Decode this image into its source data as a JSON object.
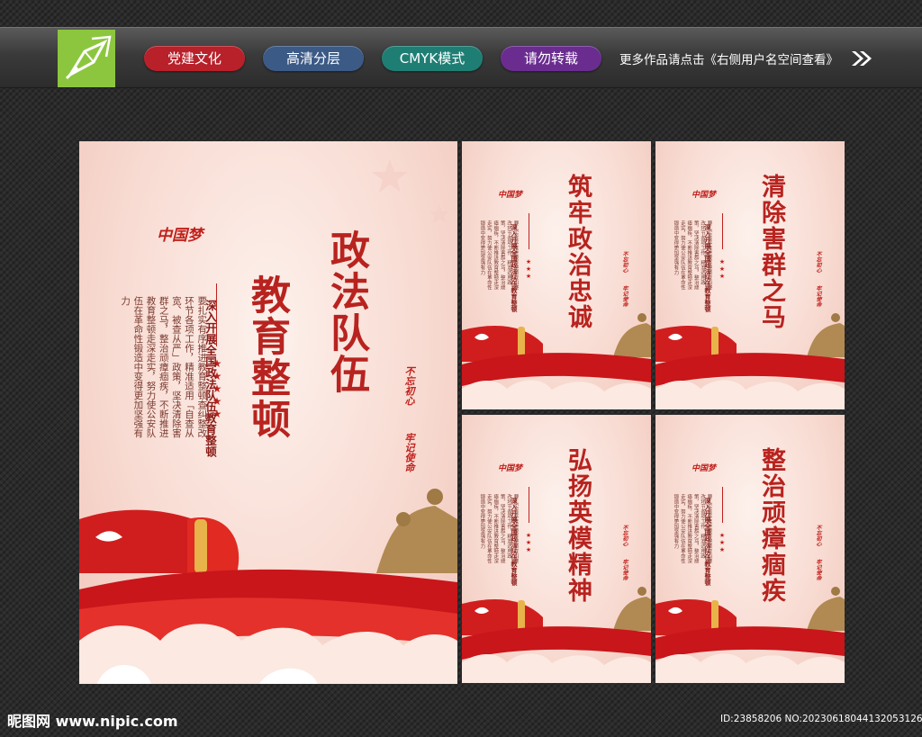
{
  "header": {
    "pills": [
      {
        "label": "党建文化",
        "color": "#b8202a"
      },
      {
        "label": "高清分层",
        "color": "#3c5a86"
      },
      {
        "label": "CMYK模式",
        "color": "#1f7e74"
      },
      {
        "label": "请勿转载",
        "color": "#6a2d8f"
      }
    ],
    "more_text": "更多作品请点击《右侧用户名空间查看》",
    "logo_icon": "pen-nib-icon",
    "arrow_icon": "double-chevron-right-icon"
  },
  "main_poster": {
    "title_line1": "政法队伍",
    "title_line2": "教育整顿",
    "china_dream": "中国梦",
    "subtitle": "深入开展全国政法队伍教育整顿",
    "body": "要扎实有序推进教育整顿查纠整改环节各项工作，精准适用「自查从宽、被查从严」政策，坚决清除害群之马，整治顽瘴痼疾，不断推进教育整顿走深走实，努力使公安队伍在革命性锻造中变得更加坚强有力",
    "slogan1": "不忘初心",
    "slogan2": "牢记使命"
  },
  "small_posters": [
    {
      "title": "筑牢政治忠诚"
    },
    {
      "title": "清除害群之马"
    },
    {
      "title": "弘扬英模精神"
    },
    {
      "title": "整治顽瘴痼疾"
    }
  ],
  "small_common": {
    "china_dream": "中国梦",
    "subtitle": "深入开展全国政法队伍教育整顿",
    "body": "要扎实有序推进教育整顿查纠整改环节各项工作，精准适用政策，坚决清除害群之马，整治顽瘴痼疾，不断推进教育整顿走深走实，努力使公安队伍在革命性锻造中变得更加坚强有力",
    "slogan1": "不忘初心",
    "slogan2": "牢记使命"
  },
  "footer": {
    "left": "昵图网 www.nipic.com",
    "right": "ID:23858206 NO:20230618044132053126"
  }
}
